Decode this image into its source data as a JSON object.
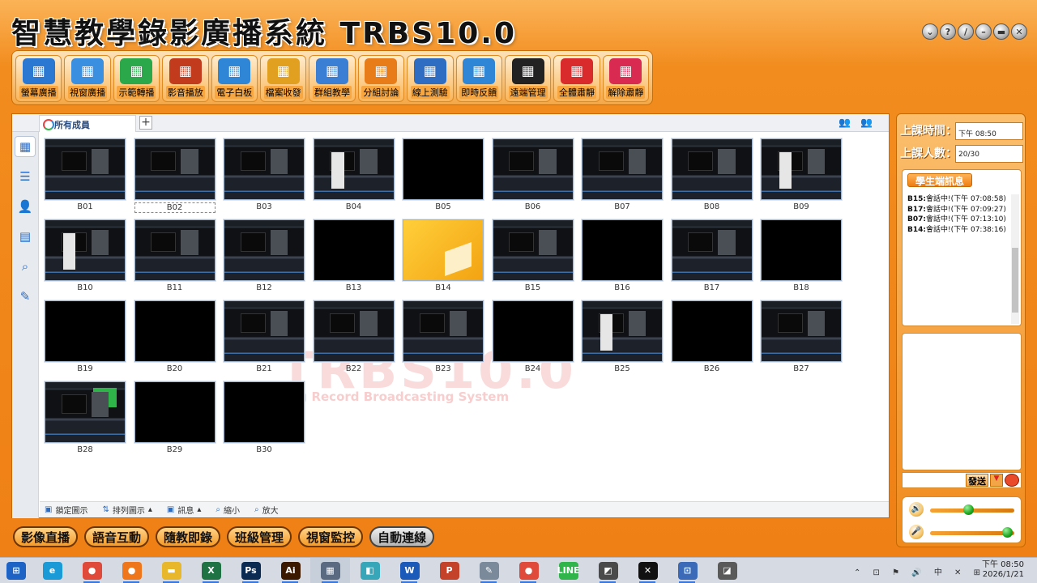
{
  "app": {
    "title": "智慧教學錄影廣播系統 TRBS10.0",
    "window_controls": [
      "minimize-alt-icon",
      "help-icon",
      "settings-icon",
      "minimize-icon",
      "restore-icon",
      "close-icon"
    ]
  },
  "toolbar": [
    {
      "label": "螢幕廣播",
      "icon": "screen-broadcast-icon",
      "color": "#2b78d2"
    },
    {
      "label": "視窗廣播",
      "icon": "window-broadcast-icon",
      "color": "#3a8fe0"
    },
    {
      "label": "示範轉播",
      "icon": "demo-relay-icon",
      "color": "#2aa84a"
    },
    {
      "label": "影音播放",
      "icon": "film-icon",
      "color": "#c23b1c"
    },
    {
      "label": "電子白板",
      "icon": "whiteboard-icon",
      "color": "#2f86d6"
    },
    {
      "label": "檔案收發",
      "icon": "file-transfer-icon",
      "color": "#e2a020"
    },
    {
      "label": "群組教學",
      "icon": "group-icon",
      "color": "#3a7fd4"
    },
    {
      "label": "分組討論",
      "icon": "discussion-icon",
      "color": "#e87c18"
    },
    {
      "label": "線上測驗",
      "icon": "quiz-icon",
      "color": "#2f6dc2"
    },
    {
      "label": "即時反饋",
      "icon": "feedback-icon",
      "color": "#2f86d6"
    },
    {
      "label": "遠端管理",
      "icon": "console-icon",
      "color": "#222222"
    },
    {
      "label": "全體肅靜",
      "icon": "silence-icon",
      "color": "#d92b2b"
    },
    {
      "label": "解除肅靜",
      "icon": "unsilence-icon",
      "color": "#d92b52"
    }
  ],
  "main": {
    "tab_label": "所有成員",
    "students": [
      {
        "id": "B01",
        "screen": "d"
      },
      {
        "id": "B02",
        "screen": "d"
      },
      {
        "id": "B03",
        "screen": "d"
      },
      {
        "id": "B04",
        "screen": "m"
      },
      {
        "id": "B05",
        "screen": "k"
      },
      {
        "id": "B06",
        "screen": "d"
      },
      {
        "id": "B07",
        "screen": "d"
      },
      {
        "id": "B08",
        "screen": "d"
      },
      {
        "id": "B09",
        "screen": "m"
      },
      {
        "id": "B10",
        "screen": "m"
      },
      {
        "id": "B11",
        "screen": "d"
      },
      {
        "id": "B12",
        "screen": "d"
      },
      {
        "id": "B13",
        "screen": "k"
      },
      {
        "id": "B14",
        "screen": "y"
      },
      {
        "id": "B15",
        "screen": "d"
      },
      {
        "id": "B16",
        "screen": "k"
      },
      {
        "id": "B17",
        "screen": "d"
      },
      {
        "id": "B18",
        "screen": "k"
      },
      {
        "id": "B19",
        "screen": "k"
      },
      {
        "id": "B20",
        "screen": "k"
      },
      {
        "id": "B21",
        "screen": "d"
      },
      {
        "id": "B22",
        "screen": "d"
      },
      {
        "id": "B23",
        "screen": "d"
      },
      {
        "id": "B24",
        "screen": "k"
      },
      {
        "id": "B25",
        "screen": "m"
      },
      {
        "id": "B26",
        "screen": "k"
      },
      {
        "id": "B27",
        "screen": "d"
      },
      {
        "id": "B28",
        "screen": "g"
      },
      {
        "id": "B29",
        "screen": "k"
      },
      {
        "id": "B30",
        "screen": "k"
      }
    ],
    "selected_student": "B02",
    "watermark": "TRBS10.0",
    "watermark_sub": "hing Record Broadcasting System",
    "bottom_bar": {
      "lock": "鎖定圖示",
      "arrange": "排列圖示",
      "info": "訊息",
      "zoom_out": "縮小",
      "zoom_in": "放大"
    }
  },
  "right_panel": {
    "class_time_label": "上課時間：",
    "class_time_value": "下午 08:50",
    "attendance_label": "上課人數：",
    "attendance_value": "20/30",
    "messages_header": "學生端訊息",
    "messages": [
      {
        "who": "B15:",
        "text": "會話中!(下午 07:08:58)"
      },
      {
        "who": "B17:",
        "text": "會話中!(下午 07:09:27)"
      },
      {
        "who": "B07:",
        "text": "會話中!(下午 07:13:10)"
      },
      {
        "who": "B14:",
        "text": "會話中!(下午 07:38:16)"
      }
    ],
    "send_label": "發送",
    "speaker_level": 0.45,
    "mic_level": 0.98
  },
  "bottom_tabs": [
    {
      "label": "影像直播",
      "active": false
    },
    {
      "label": "語音互動",
      "active": false
    },
    {
      "label": "隨教即錄",
      "active": false
    },
    {
      "label": "班級管理",
      "active": false
    },
    {
      "label": "視窗監控",
      "active": false
    },
    {
      "label": "自動連線",
      "active": true
    }
  ],
  "taskbar": {
    "apps": [
      {
        "name": "start",
        "glyph": "⊞",
        "color": "#1d63c6"
      },
      {
        "name": "edge",
        "glyph": "e",
        "color": "#1a9ad6"
      },
      {
        "name": "chrome",
        "glyph": "●",
        "color": "#e04a3a"
      },
      {
        "name": "firefox",
        "glyph": "●",
        "color": "#f0761c"
      },
      {
        "name": "file-explorer",
        "glyph": "▬",
        "color": "#e8b72a"
      },
      {
        "name": "excel",
        "glyph": "X",
        "color": "#1f7244"
      },
      {
        "name": "photoshop",
        "glyph": "Ps",
        "color": "#0b2b52"
      },
      {
        "name": "illustrator",
        "glyph": "Ai",
        "color": "#3a1900"
      },
      {
        "name": "trbs",
        "glyph": "▦",
        "color": "#5a6a80"
      },
      {
        "name": "glass-app",
        "glyph": "◧",
        "color": "#37a6b9"
      },
      {
        "name": "word",
        "glyph": "W",
        "color": "#1b5ab8"
      },
      {
        "name": "powerpoint",
        "glyph": "P",
        "color": "#c4412a"
      },
      {
        "name": "paint",
        "glyph": "✎",
        "color": "#7a8a9a"
      },
      {
        "name": "chrome-2",
        "glyph": "●",
        "color": "#e04a3a"
      },
      {
        "name": "line",
        "glyph": "LINE",
        "color": "#2fb54a"
      },
      {
        "name": "remote-app",
        "glyph": "◩",
        "color": "#4a4a4a"
      },
      {
        "name": "capcut",
        "glyph": "✕",
        "color": "#111111"
      },
      {
        "name": "network-app",
        "glyph": "⊡",
        "color": "#3b6bb8"
      },
      {
        "name": "tool-app",
        "glyph": "◪",
        "color": "#5a5a5a"
      }
    ],
    "time": "下午 08:50",
    "date": "2026/1/21"
  }
}
